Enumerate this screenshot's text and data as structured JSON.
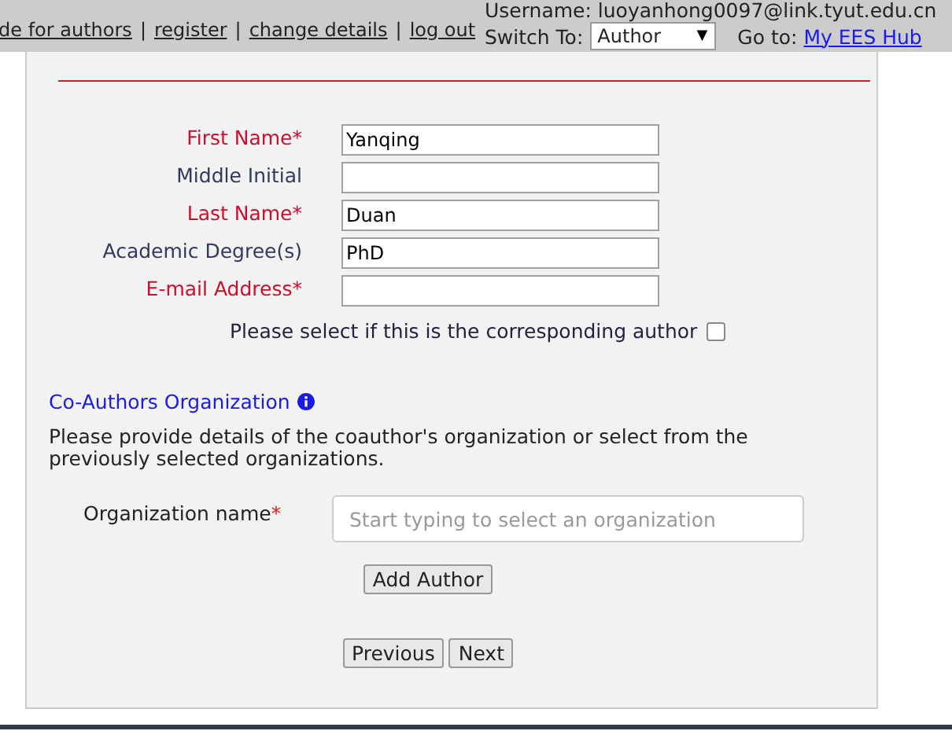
{
  "top_bar": {
    "nav": [
      {
        "kind": "link",
        "text": "de for authors"
      },
      {
        "kind": "separator",
        "text": "|"
      },
      {
        "kind": "link",
        "text": "register"
      },
      {
        "kind": "separator",
        "text": "|"
      },
      {
        "kind": "link",
        "text": "change details"
      },
      {
        "kind": "separator",
        "text": "|"
      },
      {
        "kind": "link",
        "text": "log out"
      }
    ],
    "username": "Username: luoyanhong0097@link.tyut.edu.cn",
    "switch_label": "Switch To:",
    "switch_value": "Author",
    "switch_caret": "▼",
    "goto_label": "Go to:",
    "goto_link": "My EES Hub"
  },
  "author_fields": [
    {
      "label": "First Name*",
      "required": true,
      "value": "Yanqing"
    },
    {
      "label": "Middle Initial",
      "required": false
    },
    {
      "label": "Last Name*",
      "required": true,
      "value": "Duan"
    },
    {
      "label": "Academic Degree(s)",
      "required": false,
      "value": "PhD"
    },
    {
      "label": "E-mail Address*",
      "required": true
    }
  ],
  "corresponding": {
    "label": "Please select if this is the corresponding author",
    "checked": false
  },
  "organization": {
    "heading": "Co-Authors Organization",
    "description": "Please provide details of the coauthor's organization or select from the previously selected organizations.",
    "field_label": "Organization name",
    "required_mark": "*",
    "placeholder": "Start typing to select an organization"
  },
  "add_button": "Add Author",
  "nav_buttons": [
    "Previous",
    "Next"
  ]
}
